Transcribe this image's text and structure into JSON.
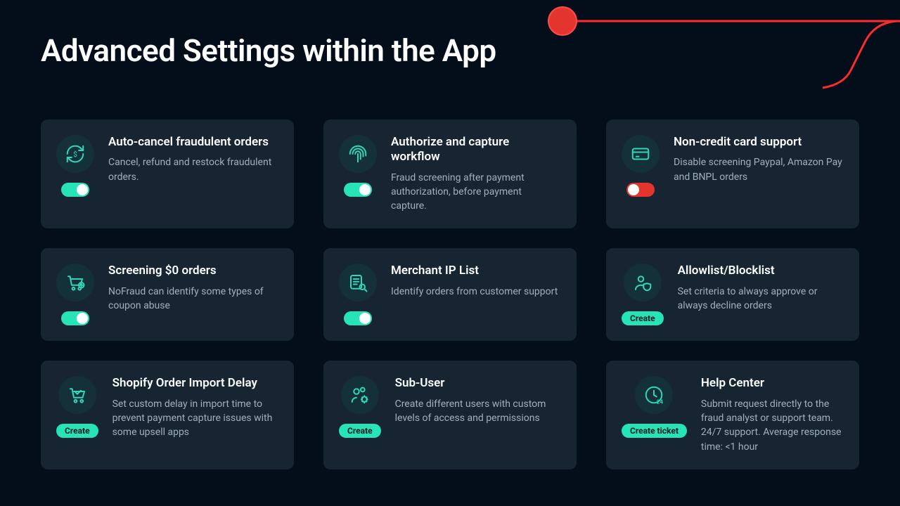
{
  "page": {
    "title": "Advanced Settings within the App"
  },
  "cards": [
    {
      "icon": "refresh-dollar-icon",
      "title": "Auto-cancel fraudulent orders",
      "desc": "Cancel, refund and restock fraudulent orders.",
      "control": {
        "type": "toggle",
        "state": "on"
      }
    },
    {
      "icon": "fingerprint-icon",
      "title": "Authorize and capture workflow",
      "desc": "Fraud screening after payment authorization, before payment capture.",
      "control": {
        "type": "toggle",
        "state": "on"
      }
    },
    {
      "icon": "credit-card-icon",
      "title": "Non-credit card support",
      "desc": "Disable screening Paypal, Amazon Pay and BNPL orders",
      "control": {
        "type": "toggle",
        "state": "off"
      }
    },
    {
      "icon": "cart-plus-icon",
      "title": "Screening $0 orders",
      "desc": "NoFraud can identify some types of coupon abuse",
      "control": {
        "type": "toggle",
        "state": "on"
      }
    },
    {
      "icon": "list-search-icon",
      "title": "Merchant IP List",
      "desc": "Identify orders from customer support",
      "control": {
        "type": "toggle",
        "state": "on"
      }
    },
    {
      "icon": "user-shield-icon",
      "title": "Allowlist/Blocklist",
      "desc": "Set criteria to always approve or always decline orders",
      "control": {
        "type": "button",
        "label": "Create"
      }
    },
    {
      "icon": "cart-check-icon",
      "title": "Shopify Order Import Delay",
      "desc": "Set custom delay in import time to prevent payment capture issues with some upsell apps",
      "control": {
        "type": "button",
        "label": "Create"
      }
    },
    {
      "icon": "users-gear-icon",
      "title": "Sub-User",
      "desc": "Create different users with custom levels of access and permissions",
      "control": {
        "type": "button",
        "label": "Create"
      }
    },
    {
      "icon": "clock-24-icon",
      "title": "Help Center",
      "desc": "Submit request directly to the fraud analyst or support team. 24/7 support. Average response time: <1 hour",
      "control": {
        "type": "button",
        "label": "Create ticket"
      }
    }
  ]
}
